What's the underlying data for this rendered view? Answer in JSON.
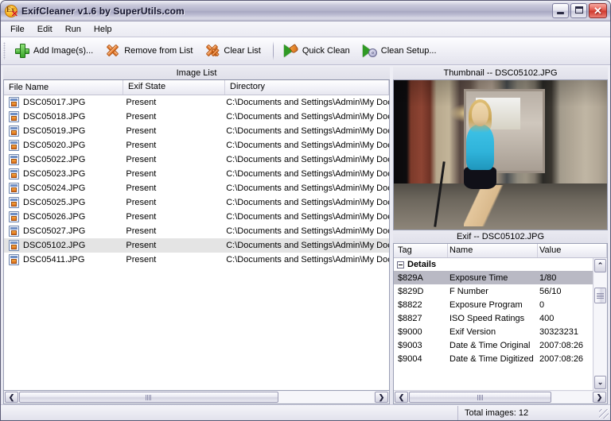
{
  "window": {
    "title": "ExifCleaner v1.6 by SuperUtils.com",
    "app_icon": "exifcleaner-icon",
    "minimize_label": "_",
    "maximize_label": "□",
    "close_label": "✕"
  },
  "menu": [
    {
      "label": "File"
    },
    {
      "label": "Edit"
    },
    {
      "label": "Run"
    },
    {
      "label": "Help"
    }
  ],
  "toolbar": {
    "items": [
      {
        "label": "Add Image(s)...",
        "icon": "plus-icon"
      },
      {
        "label": "Remove from List",
        "icon": "x-icon"
      },
      {
        "label": "Clear List",
        "icon": "double-x-icon"
      },
      {
        "label": "Quick Clean",
        "icon": "play-brush-icon"
      },
      {
        "label": "Clean Setup...",
        "icon": "play-gear-icon"
      }
    ]
  },
  "image_list": {
    "caption": "Image List",
    "columns": [
      "File Name",
      "Exif State",
      "Directory"
    ],
    "rows": [
      {
        "file": "DSC05017.JPG",
        "state": "Present",
        "dir": "C:\\Documents and Settings\\Admin\\My Doc",
        "selected": false
      },
      {
        "file": "DSC05018.JPG",
        "state": "Present",
        "dir": "C:\\Documents and Settings\\Admin\\My Doc",
        "selected": false
      },
      {
        "file": "DSC05019.JPG",
        "state": "Present",
        "dir": "C:\\Documents and Settings\\Admin\\My Doc",
        "selected": false
      },
      {
        "file": "DSC05020.JPG",
        "state": "Present",
        "dir": "C:\\Documents and Settings\\Admin\\My Doc",
        "selected": false
      },
      {
        "file": "DSC05022.JPG",
        "state": "Present",
        "dir": "C:\\Documents and Settings\\Admin\\My Doc",
        "selected": false
      },
      {
        "file": "DSC05023.JPG",
        "state": "Present",
        "dir": "C:\\Documents and Settings\\Admin\\My Doc",
        "selected": false
      },
      {
        "file": "DSC05024.JPG",
        "state": "Present",
        "dir": "C:\\Documents and Settings\\Admin\\My Doc",
        "selected": false
      },
      {
        "file": "DSC05025.JPG",
        "state": "Present",
        "dir": "C:\\Documents and Settings\\Admin\\My Doc",
        "selected": false
      },
      {
        "file": "DSC05026.JPG",
        "state": "Present",
        "dir": "C:\\Documents and Settings\\Admin\\My Doc",
        "selected": false
      },
      {
        "file": "DSC05027.JPG",
        "state": "Present",
        "dir": "C:\\Documents and Settings\\Admin\\My Doc",
        "selected": false
      },
      {
        "file": "DSC05102.JPG",
        "state": "Present",
        "dir": "C:\\Documents and Settings\\Admin\\My Doc",
        "selected": true
      },
      {
        "file": "DSC05411.JPG",
        "state": "Present",
        "dir": "C:\\Documents and Settings\\Admin\\My Doc",
        "selected": false
      }
    ],
    "scroll_left_label": "❮",
    "scroll_right_label": "❯"
  },
  "thumbnail": {
    "caption": "Thumbnail -- DSC05102.JPG"
  },
  "exif": {
    "caption": "Exif -- DSC05102.JPG",
    "columns": [
      "Tag",
      "Name",
      "Value"
    ],
    "group_label": "Details",
    "rows": [
      {
        "tag": "$829A",
        "name": "Exposure Time",
        "value": "1/80",
        "selected": true
      },
      {
        "tag": "$829D",
        "name": "F Number",
        "value": "56/10",
        "selected": false
      },
      {
        "tag": "$8822",
        "name": "Exposure Program",
        "value": "0",
        "selected": false
      },
      {
        "tag": "$8827",
        "name": "ISO Speed Ratings",
        "value": "400",
        "selected": false
      },
      {
        "tag": "$9000",
        "name": "Exif Version",
        "value": "30323231",
        "selected": false
      },
      {
        "tag": "$9003",
        "name": "Date & Time Original",
        "value": "2007:08:26",
        "selected": false
      },
      {
        "tag": "$9004",
        "name": "Date & Time Digitized",
        "value": "2007:08:26",
        "selected": false
      }
    ],
    "scroll_up_label": "⌃",
    "scroll_down_label": "⌄",
    "scroll_left_label": "❮",
    "scroll_right_label": "❯"
  },
  "statusbar": {
    "total_images": "Total images: 12"
  }
}
